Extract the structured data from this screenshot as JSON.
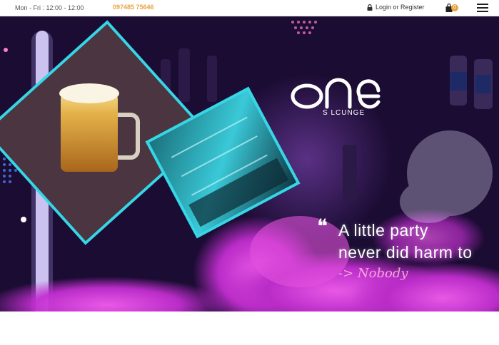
{
  "topbar": {
    "hours": "Mon - Fri : 12:00 - 12:00",
    "phone": "097485 75646",
    "login_label": "Login or Register",
    "cart_count": "0"
  },
  "icons": {
    "lock": "lock-icon",
    "cart": "shopping-bag-icon",
    "menu": "hamburger-menu-icon",
    "quote": "quote-icon"
  },
  "hero": {
    "logo_sub": "S LCUNGE",
    "quote_mark": "❝",
    "tagline_line1": "A little party",
    "tagline_line2": "never did harm to",
    "signature": "-> Nobody"
  },
  "colors": {
    "accent": "#e8a33c",
    "hero_bg": "#1f0d3c",
    "neon_cyan": "#37d6e6",
    "smoke_pink": "#e23cd6"
  }
}
